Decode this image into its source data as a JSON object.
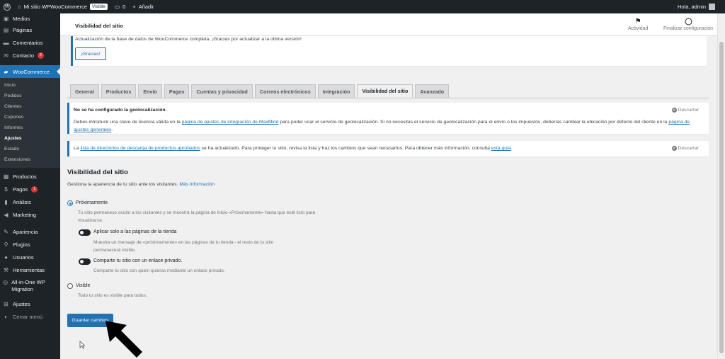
{
  "adminbar": {
    "site_name": "Mi sitio WPWooCommerce",
    "visible_badge": "Visible",
    "comments_count": "0",
    "add_new": "Añadir",
    "greeting": "Hola, admin"
  },
  "sidebar": {
    "items": [
      {
        "label": "Medios",
        "icon": "media-icon"
      },
      {
        "label": "Páginas",
        "icon": "pages-icon"
      },
      {
        "label": "Comentarios",
        "icon": "comments-icon"
      },
      {
        "label": "Contacto",
        "icon": "contact-icon",
        "badge": "2"
      },
      {
        "label": "WooCommerce",
        "icon": "woocommerce-icon"
      },
      {
        "label": "Productos",
        "icon": "products-icon"
      },
      {
        "label": "Pagos",
        "icon": "payments-icon",
        "badge": "1"
      },
      {
        "label": "Análisis",
        "icon": "analytics-icon"
      },
      {
        "label": "Marketing",
        "icon": "marketing-icon"
      },
      {
        "label": "Apariencia",
        "icon": "appearance-icon"
      },
      {
        "label": "Plugins",
        "icon": "plugins-icon"
      },
      {
        "label": "Usuarios",
        "icon": "users-icon"
      },
      {
        "label": "Herramientas",
        "icon": "tools-icon"
      },
      {
        "label": "All-in-One WP Migration",
        "icon": "migration-icon"
      },
      {
        "label": "Ajustes",
        "icon": "settings-icon"
      },
      {
        "label": "Cerrar menú",
        "icon": "collapse-icon"
      }
    ],
    "woo_submenu": [
      "Inicio",
      "Pedidos",
      "Clientes",
      "Cupones",
      "Informes",
      "Ajustes",
      "Estado",
      "Extensiones"
    ]
  },
  "header": {
    "title": "Visibilidad del sitio",
    "activity": "Actividad",
    "finish_setup": "Finalizar configuración"
  },
  "update_notice": {
    "text": "Actualización de la base de datos de WooCommerce completa. ¡Gracias por actualizar a la última versión!",
    "button": "¡Gracias!"
  },
  "tabs": [
    "General",
    "Productos",
    "Envío",
    "Pagos",
    "Cuentas y privacidad",
    "Correos electrónicos",
    "Integración",
    "Visibilidad del sitio",
    "Avanzado"
  ],
  "geo_notice": {
    "title": "No se ha configurado la geolocalización.",
    "text_1": "Debes introducir una clave de licencia válida en la",
    "link_1": "página de ajustes de integración de MaxMind",
    "text_2": "para poder usar el servicio de geolocalización. Si no necesitas el servicio de geolocalización para el envío o los impuestos, deberías cambiar la ubicación por defecto del cliente en la",
    "link_2": "página de ajustes generales",
    "text_3": ".",
    "dismiss": "Descartar"
  },
  "dirs_notice": {
    "text_1": "La",
    "link_1": "lista de directorios de descarga de productos aprobados",
    "text_2": "se ha actualizado. Para proteger tu sitio, revisa la lista y haz los cambios que sean necesarios. Para obtener más información, consulta",
    "link_2": "esta guía",
    "text_3": ".",
    "dismiss": "Descartar"
  },
  "section": {
    "title": "Visibilidad del sitio",
    "desc": "Gestiona la apariencia de tu sitio ante los visitantes.",
    "more_link": "Más información"
  },
  "options": {
    "coming_soon_label": "Próximamente",
    "coming_soon_help": "Tu sitio permanece oculto a los visitantes y se muestra la página de inicio «Próximamente» hasta que esté listo para visualizarse.",
    "store_only_label": "Aplicar solo a las páginas de la tienda",
    "store_only_help": "Muestra un mensaje de «próximamente» en las páginas de tu tienda - el resto de tu sitio permanecerá visible.",
    "private_link_label": "Comparte tu sitio con un enlace privado.",
    "private_link_help": "Comparte tu sitio con quien quieras mediante un enlace privado.",
    "visible_label": "Visible",
    "visible_help": "Todo tu sitio es visible para todos.",
    "selected": "Próximamente"
  },
  "save_button": "Guardar cambios",
  "colors": {
    "accent": "#2271b1",
    "admin_bg": "#1d2327",
    "notice_badge": "#d63638"
  }
}
